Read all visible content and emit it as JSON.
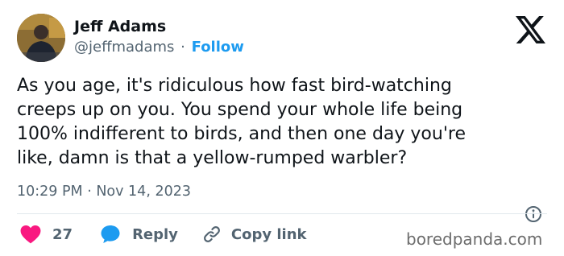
{
  "author": {
    "name": "Jeff Adams",
    "handle": "@jeffmadams",
    "separator": "·",
    "follow_label": "Follow",
    "avatar_icon": "profile-photo"
  },
  "tweet": {
    "text": "As you age, it's ridiculous how fast bird-watching\ncreeps up on you. You spend your whole life being\n100% indifferent to birds, and then one day you're\nlike, damn is that a yellow-rumped warbler?",
    "timestamp": "10:29 PM · Nov 14, 2023"
  },
  "actions": {
    "like_count": "27",
    "reply_label": "Reply",
    "copy_link_label": "Copy link"
  },
  "icons": {
    "platform": "x-logo-icon",
    "info": "info-icon",
    "like": "heart-icon",
    "reply": "speech-bubble-icon",
    "copy": "link-icon"
  },
  "colors": {
    "accent": "#1d9bf0",
    "heart": "#f91880",
    "text": "#0f1419",
    "muted": "#536471"
  },
  "watermark": "boredpanda.com"
}
